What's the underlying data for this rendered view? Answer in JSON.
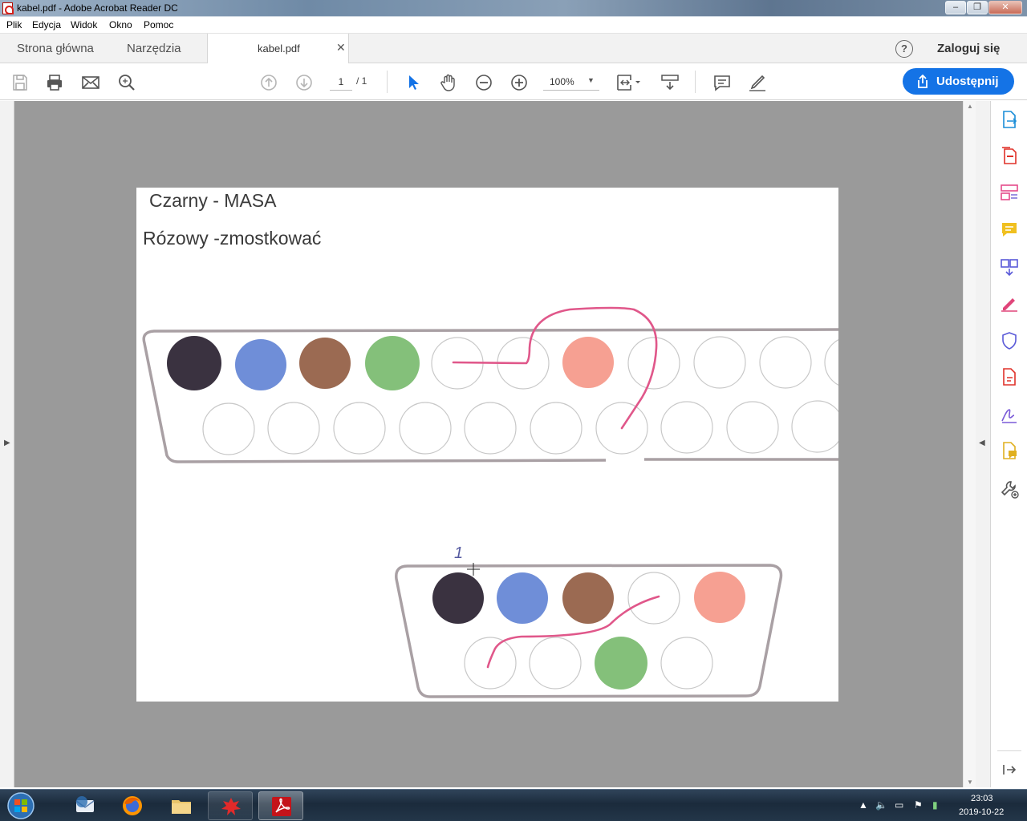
{
  "window": {
    "title": "kabel.pdf - Adobe Acrobat Reader DC",
    "controls": {
      "minimize": "–",
      "maximize": "❐",
      "close": "✕"
    }
  },
  "menu": {
    "items": [
      "Plik",
      "Edycja",
      "Widok",
      "Okno",
      "Pomoc"
    ]
  },
  "tabs": {
    "home": "Strona główna",
    "tools": "Narzędzia",
    "document": "kabel.pdf",
    "close": "✕"
  },
  "header": {
    "help": "?",
    "login": "Zaloguj się"
  },
  "toolbar": {
    "page_current": "1",
    "page_total": "/ 1",
    "zoom": "100%",
    "share": "Udostępnij"
  },
  "document": {
    "line1": "Czarny - MASA",
    "line2": "Rózowy -zmostkować",
    "handwritten_mark": "1",
    "pin_colors": {
      "black": "#3a3240",
      "blue": "#6f8ed8",
      "brown": "#9b6a52",
      "green": "#84c07a",
      "pink": "#f6a092",
      "wire": "#e0578a"
    }
  },
  "taskbar": {
    "apps": [
      "thunderbird-icon",
      "firefox-icon",
      "explorer-icon",
      "paint-icon",
      "acrobat-icon"
    ],
    "time": "23:03",
    "date": "2019-10-22"
  },
  "colors": {
    "accent": "#1473e6",
    "doc_background": "#9a9a9a"
  }
}
